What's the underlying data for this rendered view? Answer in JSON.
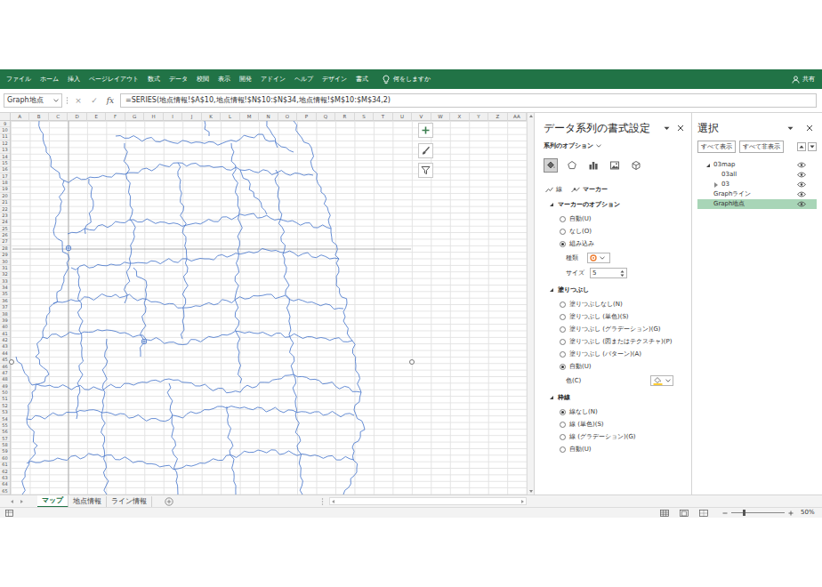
{
  "ribbon": {
    "tabs": [
      {
        "label": "ファイル",
        "selected": false
      },
      {
        "label": "ホーム",
        "selected": false
      },
      {
        "label": "挿入",
        "selected": false
      },
      {
        "label": "ページレイアウト",
        "selected": false
      },
      {
        "label": "数式",
        "selected": false
      },
      {
        "label": "データ",
        "selected": false
      },
      {
        "label": "校閲",
        "selected": false
      },
      {
        "label": "表示",
        "selected": false
      },
      {
        "label": "開発",
        "selected": false
      },
      {
        "label": "アドイン",
        "selected": false
      },
      {
        "label": "ヘルプ",
        "selected": false
      },
      {
        "label": "デザイン",
        "selected": false
      },
      {
        "label": "書式",
        "selected": false
      }
    ],
    "tell_me": "何をしますか",
    "share": "共有"
  },
  "formula_bar": {
    "name_box": "Graph地点",
    "cancel": "×",
    "confirm": "✓",
    "function": "fx",
    "formula": "=SERIES(地点情報!$A$10,地点情報!$N$10:$N$34,地点情報!$M$10:$M$34,2)"
  },
  "sheet": {
    "columns": [
      "A",
      "B",
      "C",
      "D",
      "E",
      "F",
      "G",
      "H",
      "I",
      "J",
      "K",
      "L",
      "M",
      "N",
      "O",
      "P",
      "Q",
      "R",
      "S",
      "T",
      "U",
      "V",
      "W",
      "X",
      "Y",
      "Z",
      "AA"
    ],
    "rows": [
      "9",
      "10",
      "11",
      "12",
      "13",
      "14",
      "15",
      "16",
      "17",
      "18",
      "19",
      "20",
      "21",
      "22",
      "23",
      "24",
      "25",
      "26",
      "27",
      "28",
      "29",
      "30",
      "31",
      "32",
      "33",
      "34",
      "35",
      "36",
      "37",
      "38",
      "39",
      "40",
      "41",
      "42",
      "43",
      "44",
      "45",
      "46",
      "47",
      "48",
      "49",
      "50",
      "51",
      "52",
      "53",
      "54",
      "55",
      "56",
      "57",
      "58",
      "59",
      "60",
      "61",
      "62",
      "63",
      "64",
      "65"
    ]
  },
  "chart": {
    "series": [
      {
        "points": [
          {
            "x": 14,
            "y": 66
          },
          {
            "x": 33,
            "y": 41
          }
        ]
      }
    ]
  },
  "format_pane": {
    "title": "データ系列の書式設定",
    "options_label": "系列のオプション",
    "icon_tabs": [
      {
        "selected": true
      },
      {
        "selected": false
      },
      {
        "selected": false
      },
      {
        "selected": false
      },
      {
        "selected": false
      }
    ],
    "sub_tabs": [
      {
        "label": "線",
        "selected": false
      },
      {
        "label": "マーカー",
        "selected": true
      }
    ],
    "sections": [
      {
        "title": "マーカーのオプション",
        "expanded": true,
        "options": [
          {
            "label": "自動(U)",
            "selected": false
          },
          {
            "label": "なし(O)",
            "selected": false
          },
          {
            "label": "組み込み",
            "selected": true
          }
        ],
        "fields": [
          {
            "label": "種類",
            "kind": "marker"
          },
          {
            "label": "サイズ",
            "kind": "spin",
            "value": "5"
          }
        ]
      },
      {
        "title": "塗りつぶし",
        "expanded": true,
        "options": [
          {
            "label": "塗りつぶしなし(N)",
            "selected": false
          },
          {
            "label": "塗りつぶし (単色)(S)",
            "selected": false
          },
          {
            "label": "塗りつぶし (グラデーション)(G)",
            "selected": false
          },
          {
            "label": "塗りつぶし (図またはテクスチャ)(P)",
            "selected": false
          },
          {
            "label": "塗りつぶし (パターン)(A)",
            "selected": false
          },
          {
            "label": "自動(U)",
            "selected": true
          }
        ],
        "fields": [
          {
            "label": "色(C)",
            "kind": "color"
          }
        ]
      },
      {
        "title": "枠線",
        "expanded": true,
        "options": [
          {
            "label": "線なし(N)",
            "selected": true
          },
          {
            "label": "線 (単色)(S)",
            "selected": false
          },
          {
            "label": "線 (グラデーション)(G)",
            "selected": false
          },
          {
            "label": "自動(U)",
            "selected": false
          }
        ],
        "fields": []
      }
    ]
  },
  "selection_pane": {
    "title": "選択",
    "buttons": [
      "すべて表示",
      "すべて非表示"
    ],
    "items": [
      {
        "label": "03map",
        "expanded": true,
        "visible": true,
        "selected": false,
        "children": [
          {
            "label": "03all",
            "visible": true,
            "selected": false
          },
          {
            "label": "03",
            "expanded": false,
            "visible": true,
            "selected": false
          }
        ]
      },
      {
        "label": "Graphライン",
        "visible": true,
        "selected": false
      },
      {
        "label": "Graph地点",
        "visible": true,
        "selected": true
      }
    ]
  },
  "sheet_tabs": [
    {
      "label": "マップ",
      "selected": true
    },
    {
      "label": "地点情報",
      "selected": false
    },
    {
      "label": "ライン情報",
      "selected": false
    }
  ],
  "status_bar": {
    "zoom": "50%"
  }
}
